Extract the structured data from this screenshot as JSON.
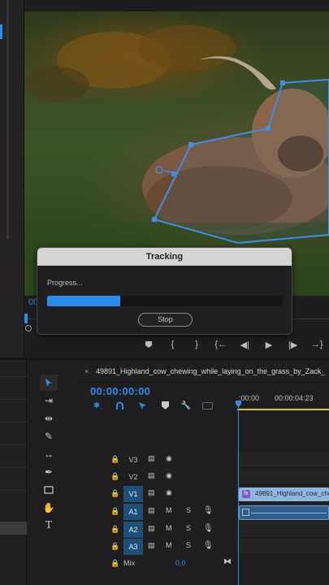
{
  "monitor": {
    "timecode_partial": "00",
    "transport": [
      "marker",
      "in-point",
      "out-point",
      "go-to-in",
      "step-back",
      "play",
      "step-forward",
      "go-to-out"
    ]
  },
  "tracking_dialog": {
    "title": "Tracking",
    "progress_label": "Progress...",
    "progress_fraction": 0.31,
    "stop_label": "Stop"
  },
  "timeline": {
    "tab_close": "×",
    "sequence_name": "49891_Highland_cow_chewing_while_laying_on_the_grass_by_Zack_",
    "timecode": "00:00:00:00",
    "ruler_ticks": [
      ":00:00",
      "00:00:04:23"
    ],
    "tracks": [
      {
        "name": "V3",
        "type": "video",
        "targeted": false
      },
      {
        "name": "V2",
        "type": "video",
        "targeted": false
      },
      {
        "name": "V1",
        "type": "video",
        "targeted": true
      },
      {
        "name": "A1",
        "type": "audio",
        "targeted": true,
        "m": "M",
        "s": "S"
      },
      {
        "name": "A2",
        "type": "audio",
        "targeted": true,
        "m": "M",
        "s": "S"
      },
      {
        "name": "A3",
        "type": "audio",
        "targeted": true,
        "m": "M",
        "s": "S"
      }
    ],
    "clip_v1": {
      "fx": "fx",
      "name": "49891_Highland_cow_che"
    },
    "mix": {
      "label": "Mix",
      "value": "0,0"
    }
  },
  "colors": {
    "accent": "#2d8ceb",
    "track_target": "#1f4f78",
    "clip_video": "#8fb6de",
    "clip_audio": "#2f5e8c",
    "ruler_work_area": "#d4c82b"
  },
  "icons": {
    "tools": [
      "selection-arrow-icon",
      "track-select-forward-icon",
      "ripple-edit-icon",
      "razor-icon",
      "slip-icon",
      "pen-icon",
      "rectangle-icon",
      "hand-icon",
      "type-icon"
    ],
    "sequence_tools": [
      "nest-icon",
      "snap-magnet-icon",
      "linked-selection-icon",
      "add-marker-icon",
      "wrench-icon",
      "captions-icon"
    ]
  }
}
